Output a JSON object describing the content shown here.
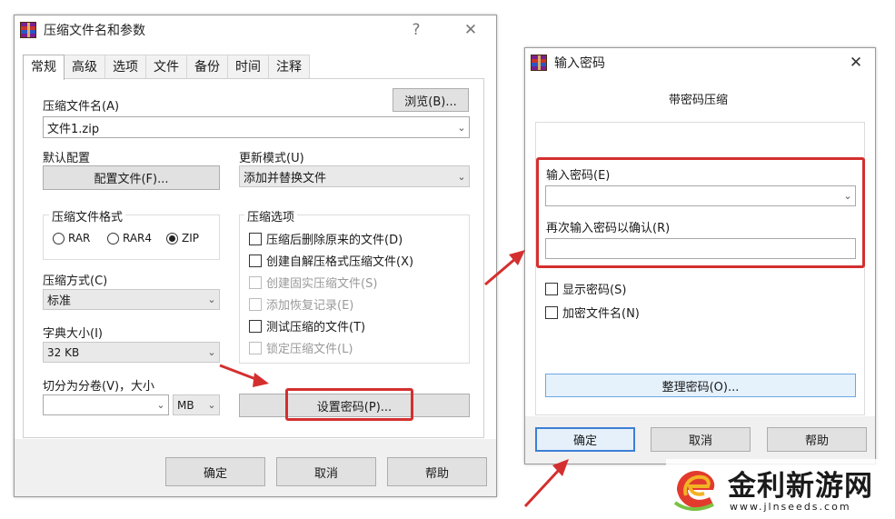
{
  "left_dialog": {
    "title": "压缩文件名和参数",
    "help_icon_glyph": "?",
    "close_glyph": "✕",
    "tabs": [
      "常规",
      "高级",
      "选项",
      "文件",
      "备份",
      "时间",
      "注释"
    ],
    "archive_name_label": "压缩文件名(A)",
    "archive_name_value": "文件1.zip",
    "browse_button": "浏览(B)...",
    "default_profile_label": "默认配置",
    "profiles_button": "配置文件(F)...",
    "update_mode_label": "更新模式(U)",
    "update_mode_value": "添加并替换文件",
    "format_group_title": "压缩文件格式",
    "formats": [
      {
        "label": "RAR",
        "selected": false
      },
      {
        "label": "RAR4",
        "selected": false
      },
      {
        "label": "ZIP",
        "selected": true
      }
    ],
    "method_label": "压缩方式(C)",
    "method_value": "标准",
    "dict_label": "字典大小(I)",
    "dict_value": "32 KB",
    "split_label": "切分为分卷(V)，大小",
    "split_value": "",
    "split_unit": "MB",
    "options_group_title": "压缩选项",
    "options": [
      {
        "label": "压缩后删除原来的文件(D)",
        "checked": false,
        "disabled": false
      },
      {
        "label": "创建自解压格式压缩文件(X)",
        "checked": false,
        "disabled": false
      },
      {
        "label": "创建固实压缩文件(S)",
        "checked": false,
        "disabled": true
      },
      {
        "label": "添加恢复记录(E)",
        "checked": false,
        "disabled": true
      },
      {
        "label": "测试压缩的文件(T)",
        "checked": false,
        "disabled": false
      },
      {
        "label": "锁定压缩文件(L)",
        "checked": false,
        "disabled": true
      }
    ],
    "set_password_button": "设置密码(P)...",
    "ok_button": "确定",
    "cancel_button": "取消",
    "help_button": "帮助"
  },
  "right_dialog": {
    "title": "输入密码",
    "close_glyph": "✕",
    "heading": "带密码压缩",
    "password_label": "输入密码(E)",
    "password_value": "",
    "confirm_label": "再次输入密码以确认(R)",
    "confirm_value": "",
    "show_password": "显示密码(S)",
    "encrypt_names": "加密文件名(N)",
    "organize_button": "整理密码(O)...",
    "ok_button": "确定",
    "cancel_button": "取消",
    "help_button": "帮助"
  },
  "watermark": {
    "text": "金利新游网",
    "url": "www.jlnseeds.com"
  },
  "colors": {
    "highlight_red": "#d42f2f",
    "accent_blue": "#3c7fd6"
  }
}
